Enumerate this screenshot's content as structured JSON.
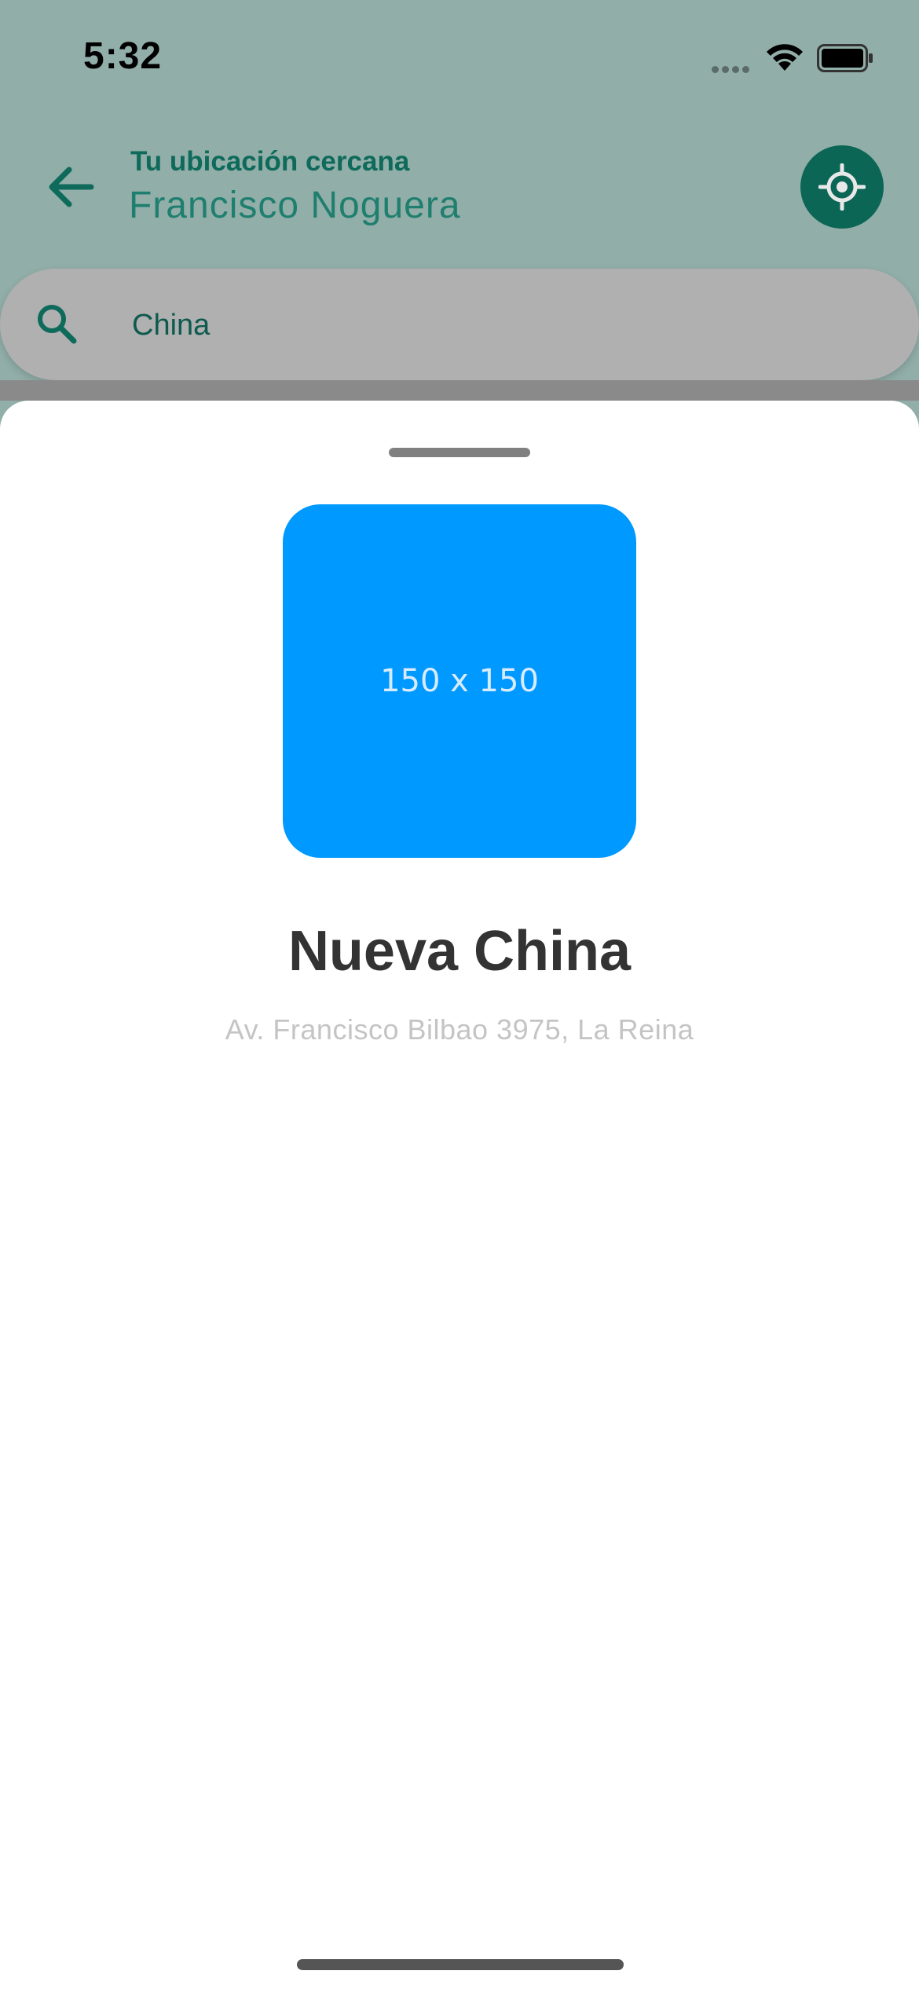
{
  "status_bar": {
    "time": "5:32"
  },
  "header": {
    "location_label": "Tu ubicación cercana",
    "location_value": "Francisco Noguera"
  },
  "search": {
    "value": "China"
  },
  "sheet": {
    "image_text": "150 x 150",
    "place_name": "Nueva China",
    "place_address": "Av. Francisco Bilbao 3975, La Reina"
  },
  "colors": {
    "accent": "#0b6656",
    "image_bg": "#0099ff"
  },
  "icons": [
    "arrow-left-icon",
    "crosshair-icon",
    "search-icon",
    "wifi-icon",
    "battery-icon",
    "signal-icon"
  ]
}
